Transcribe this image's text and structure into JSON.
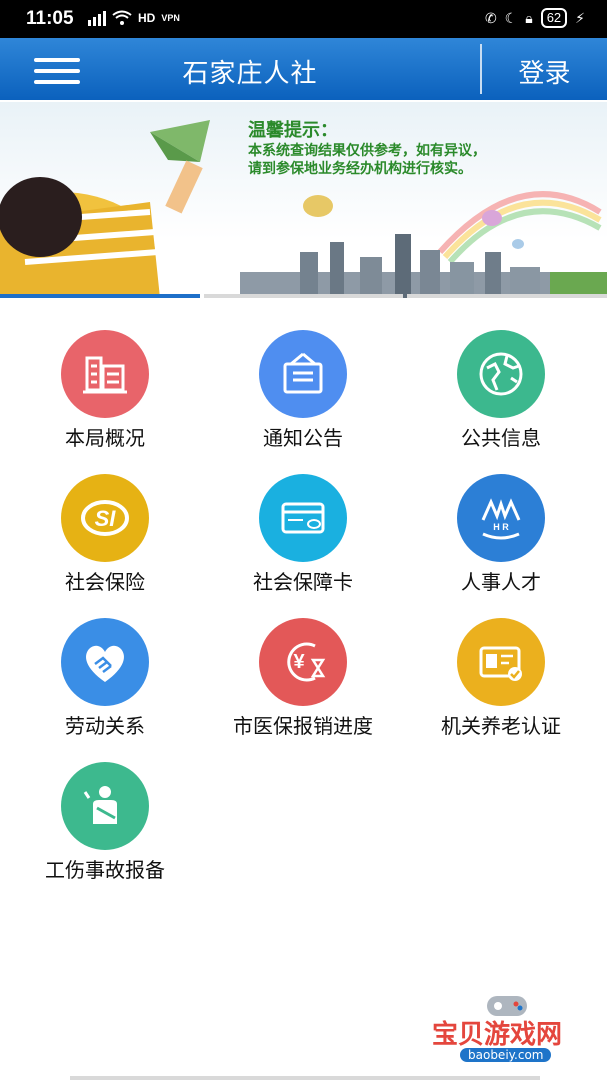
{
  "status_bar": {
    "time": "11:05",
    "left_icons": [
      "signal-4g-icon",
      "wifi-icon",
      "hd-icon",
      "vpn-icon"
    ],
    "hd": "HD",
    "vpn": "VPN",
    "battery": "62"
  },
  "header": {
    "title": "石家庄人社",
    "login_label": "登录"
  },
  "banner": {
    "title": "温馨提示：",
    "line1": "本系统查询结果仅供参考，如有异议，",
    "line2": "请到参保地业务经办机构进行核实。",
    "page_count": 3,
    "active_page": 1
  },
  "grid": {
    "items": [
      {
        "label": "本局概况",
        "icon": "building-icon",
        "color": "#e8646a"
      },
      {
        "label": "通知公告",
        "icon": "notice-board-icon",
        "color": "#4f8ef0"
      },
      {
        "label": "公共信息",
        "icon": "globe-icon",
        "color": "#3cb88e"
      },
      {
        "label": "社会保险",
        "icon": "si-logo-icon",
        "color": "#e6b214"
      },
      {
        "label": "社会保障卡",
        "icon": "card-icon",
        "color": "#1ab0e0"
      },
      {
        "label": "人事人才",
        "icon": "hr-logo-icon",
        "color": "#2c7fd6"
      },
      {
        "label": "劳动关系",
        "icon": "handshake-heart-icon",
        "color": "#3a8ee6"
      },
      {
        "label": "市医保报销进度",
        "icon": "yen-hourglass-icon",
        "color": "#e35858"
      },
      {
        "label": "机关养老认证",
        "icon": "id-check-icon",
        "color": "#ebb01e"
      },
      {
        "label": "工伤事故报备",
        "icon": "injury-person-icon",
        "color": "#3db98e"
      }
    ]
  },
  "watermark": {
    "text": "宝贝游戏网",
    "sub": "baobeiy.com"
  }
}
